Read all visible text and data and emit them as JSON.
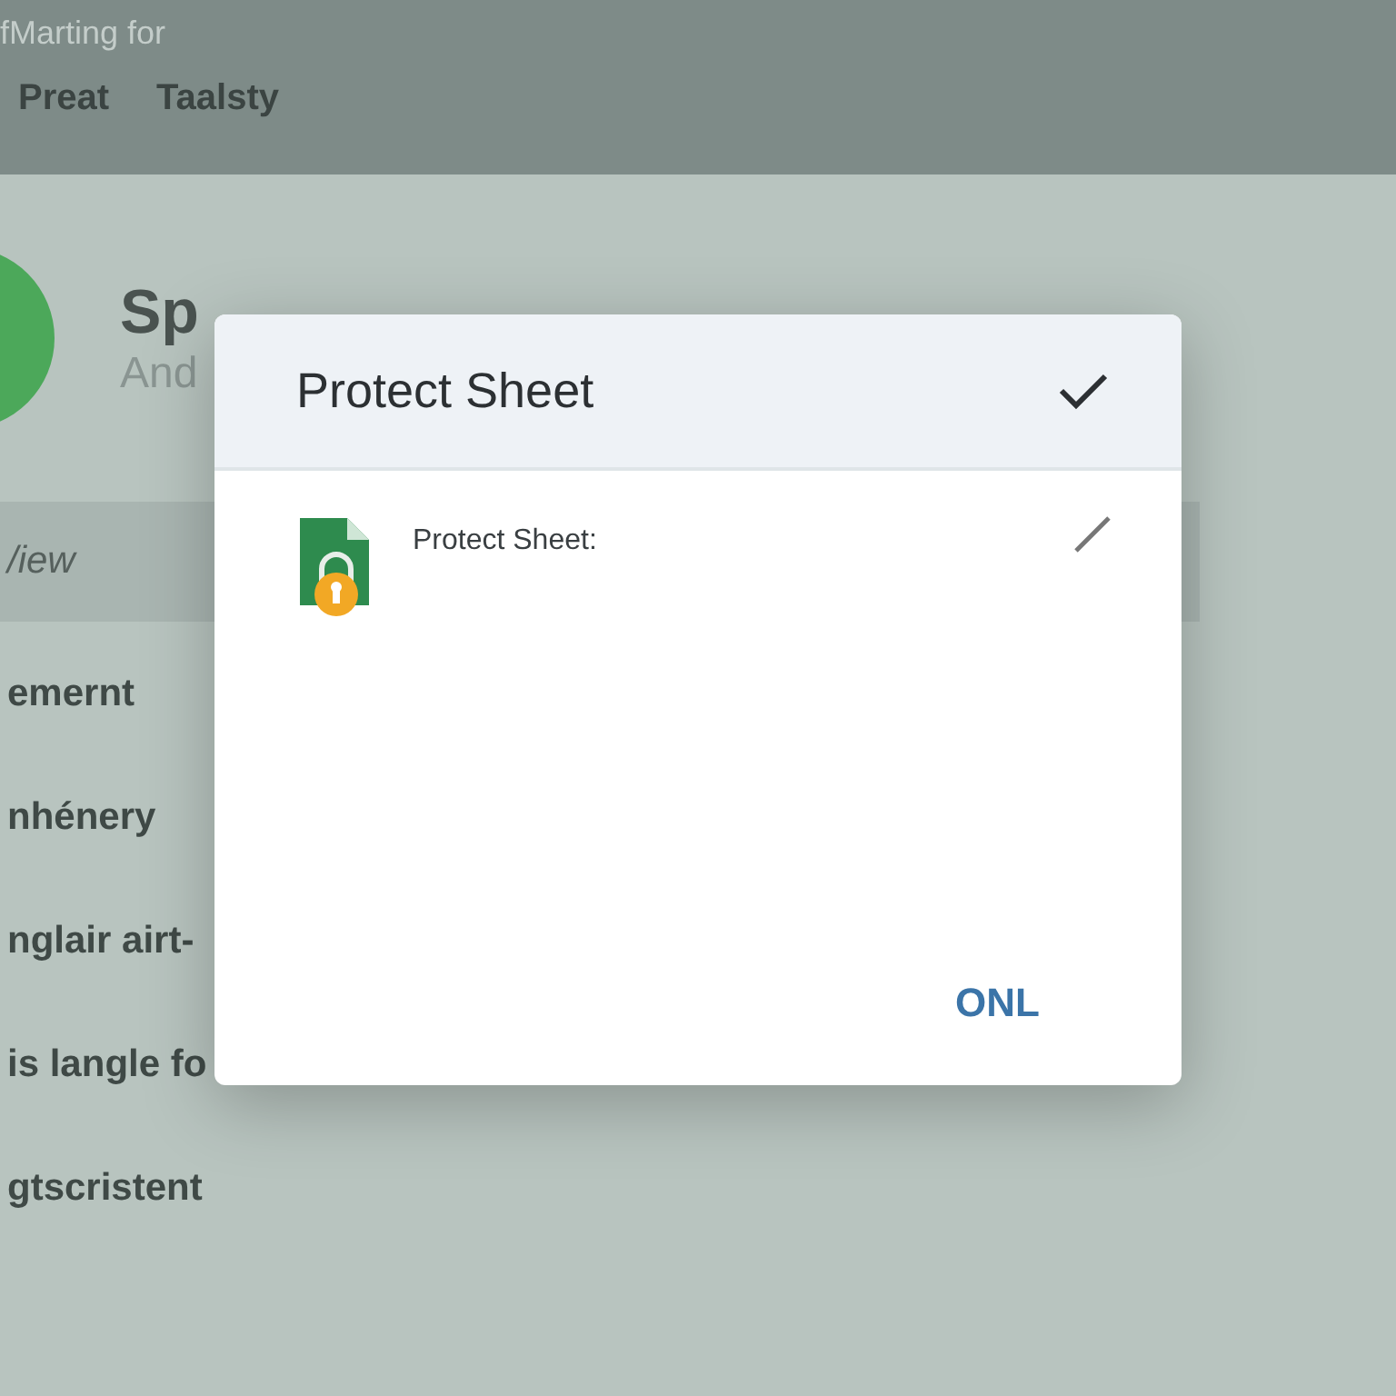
{
  "top_bar": {
    "caption": "fMarting for",
    "menu": [
      {
        "label": "Preat"
      },
      {
        "label": "Taalsty"
      }
    ]
  },
  "header": {
    "title": "Sp",
    "subtitle": "And"
  },
  "sidebar": {
    "items": [
      {
        "label": "/iew",
        "selected": true
      },
      {
        "label": "emernt",
        "selected": false
      },
      {
        "label": "nhénery",
        "selected": false
      },
      {
        "label": "nglair airt-",
        "selected": false
      },
      {
        "label": "is langle fo",
        "selected": false
      },
      {
        "label": "gtscristent",
        "selected": false
      }
    ]
  },
  "dialog": {
    "title": "Protect Sheet",
    "row_label": "Protect Sheet:",
    "button": "ONL"
  }
}
